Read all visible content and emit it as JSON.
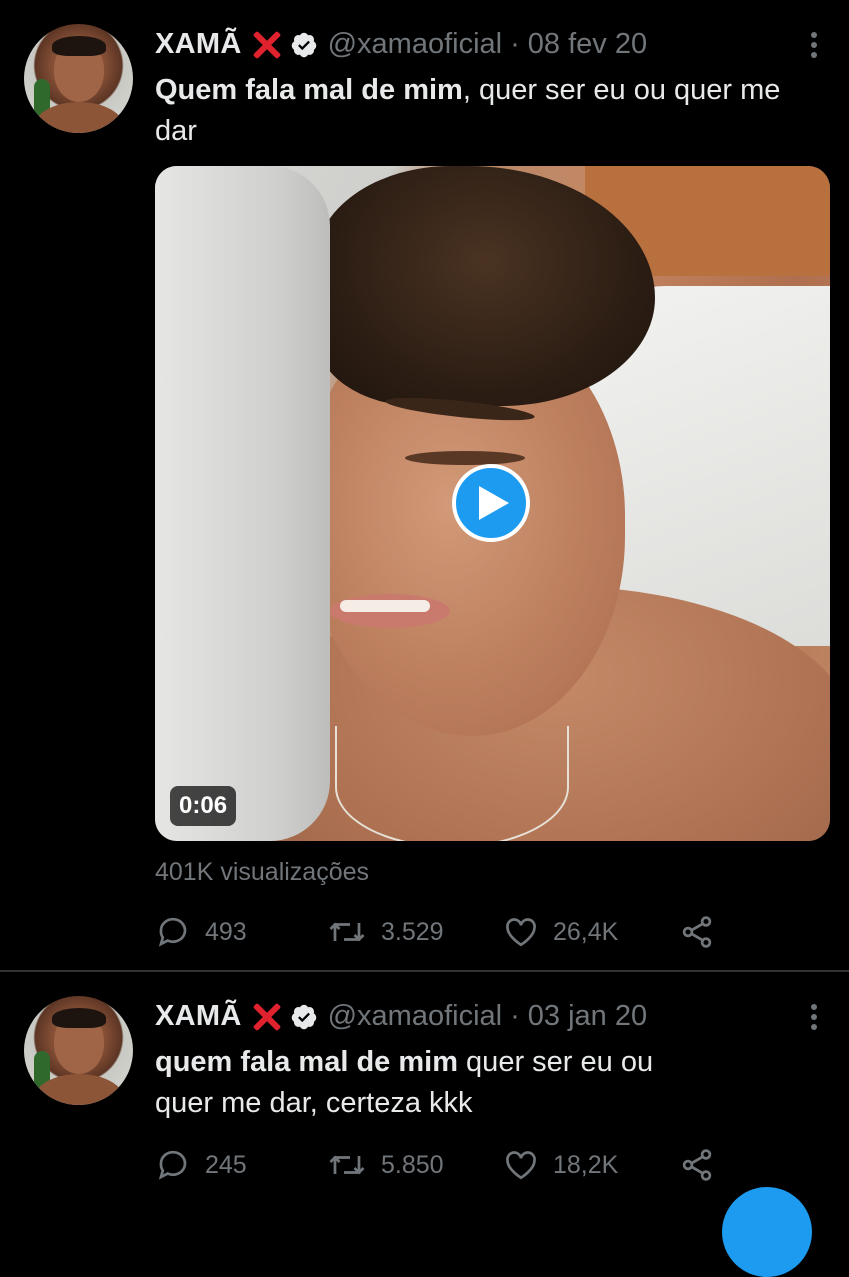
{
  "tweets": [
    {
      "author_name": "XAMÃ",
      "handle": "@xamaoficial",
      "separator": "·",
      "date": "08 fev 20",
      "text_bold": "Quem fala mal de mim",
      "text_rest": ", quer ser eu ou quer me dar",
      "video": {
        "duration": "0:06"
      },
      "views": "401K visualizações",
      "replies": "493",
      "retweets": "3.529",
      "likes": "26,4K"
    },
    {
      "author_name": "XAMÃ",
      "handle": "@xamaoficial",
      "separator": "·",
      "date": "03 jan 20",
      "text_bold": "quem fala mal de mim",
      "text_rest": " quer ser  eu ou quer me dar, certeza kkk",
      "replies": "245",
      "retweets": "5.850",
      "likes": "18,2K"
    }
  ],
  "colors": {
    "background": "#000000",
    "text": "#e7e9ea",
    "muted": "#71767b",
    "accent": "#1d9bf0",
    "x_mark": "#e0222f"
  }
}
